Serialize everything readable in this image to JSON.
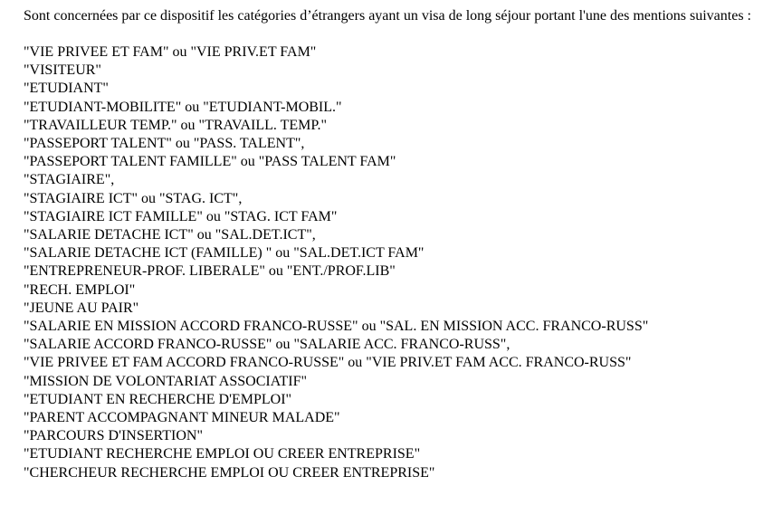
{
  "document": {
    "intro": "Sont concernées par ce dispositif les catégories d’étrangers ayant un visa de long séjour portant l'une des mentions suivantes :",
    "mentions": [
      "\"VIE PRIVEE ET FAM\" ou \"VIE PRIV.ET FAM\"",
      "\"VISITEUR\"",
      "\"ETUDIANT\"",
      "\"ETUDIANT-MOBILITE\" ou \"ETUDIANT-MOBIL.\"",
      "\"TRAVAILLEUR TEMP.\" ou \"TRAVAILL. TEMP.\"",
      "\"PASSEPORT TALENT\" ou \"PASS. TALENT\",",
      "\"PASSEPORT TALENT FAMILLE\" ou \"PASS TALENT FAM\"",
      "\"STAGIAIRE\",",
      "\"STAGIAIRE ICT\" ou \"STAG. ICT\",",
      "\"STAGIAIRE ICT FAMILLE\" ou \"STAG. ICT FAM\"",
      "\"SALARIE DETACHE ICT\" ou \"SAL.DET.ICT\",",
      "\"SALARIE DETACHE ICT (FAMILLE) \" ou \"SAL.DET.ICT FAM\"",
      "\"ENTREPRENEUR-PROF. LIBERALE\" ou \"ENT./PROF.LIB\"",
      "\"RECH. EMPLOI\"",
      "\"JEUNE AU PAIR\"",
      "\"SALARIE EN MISSION ACCORD FRANCO-RUSSE\" ou \"SAL. EN MISSION ACC. FRANCO-RUSS\"",
      "\"SALARIE ACCORD FRANCO-RUSSE\" ou \"SALARIE ACC. FRANCO-RUSS\",",
      "\"VIE PRIVEE ET FAM ACCORD FRANCO-RUSSE\" ou \"VIE PRIV.ET FAM ACC. FRANCO-RUSS\"",
      "\"MISSION DE VOLONTARIAT ASSOCIATIF\"",
      "\"ETUDIANT EN RECHERCHE D'EMPLOI\"",
      "\"PARENT ACCOMPAGNANT MINEUR MALADE\"",
      "\"PARCOURS D'INSERTION\"",
      "\"ETUDIANT RECHERCHE EMPLOI OU CREER ENTREPRISE\"",
      "\"CHERCHEUR RECHERCHE EMPLOI OU CREER ENTREPRISE\""
    ]
  }
}
